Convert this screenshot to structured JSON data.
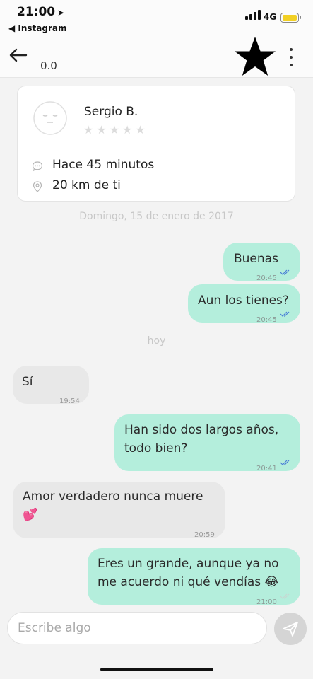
{
  "status_bar": {
    "time": "21:00",
    "back_app": "◀ Instagram",
    "network": "4G"
  },
  "header": {
    "rating": "0.0"
  },
  "profile": {
    "name": "Sergio B.",
    "star_rating": 0,
    "last_seen": "Hace 45 minutos",
    "distance": "20 km de ti"
  },
  "date_separators": {
    "first": "Domingo, 15 de enero de 2017",
    "second": "hoy"
  },
  "messages": [
    {
      "direction": "out",
      "text": "Buenas",
      "time": "20:45",
      "status": "read"
    },
    {
      "direction": "out",
      "text": "Aun los tienes?",
      "time": "20:45",
      "status": "read"
    },
    {
      "direction": "in",
      "text": "Sí",
      "time": "19:54"
    },
    {
      "direction": "out",
      "text": "Han sido dos largos años,\ntodo bien?",
      "time": "20:41",
      "status": "read"
    },
    {
      "direction": "in",
      "text": "Amor verdadero nunca muere\n💕",
      "time": "20:59"
    },
    {
      "direction": "out",
      "text": "Eres un grande, aunque ya no\nme acuerdo ni qué vendías 😂",
      "time": "21:00",
      "status": "sent"
    }
  ],
  "composer": {
    "placeholder": "Escribe algo"
  },
  "colors": {
    "outgoing_bubble": "#b4eedc",
    "incoming_bubble": "#e8e8e8",
    "read_ticks": "#4a7fd6",
    "battery": "#f2d024"
  }
}
